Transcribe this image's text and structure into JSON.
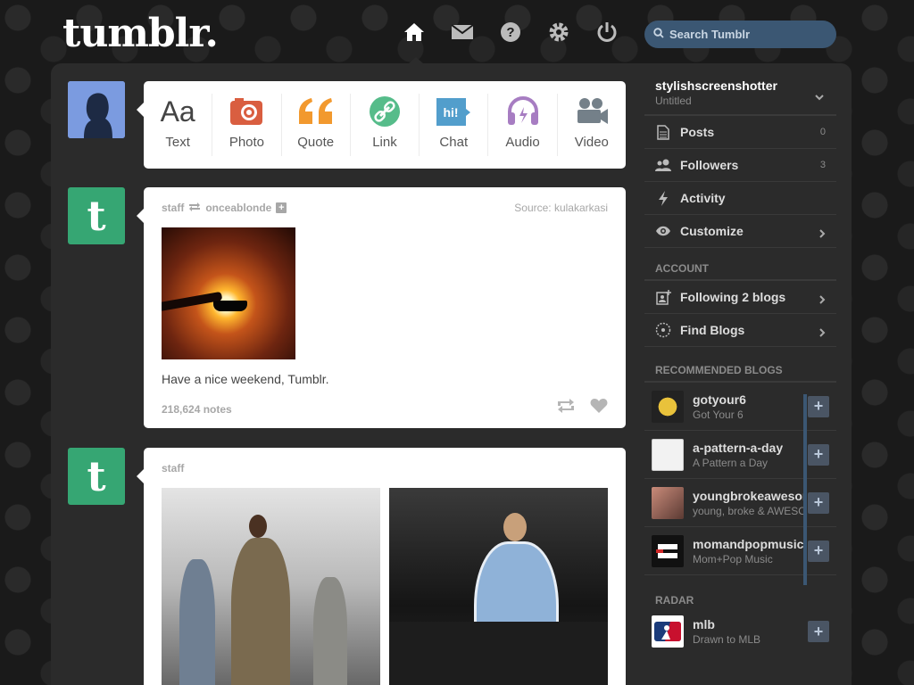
{
  "header": {
    "logo": "tumblr.",
    "nav": [
      {
        "name": "home-icon"
      },
      {
        "name": "mail-icon"
      },
      {
        "name": "help-icon"
      },
      {
        "name": "gear-icon"
      },
      {
        "name": "power-icon"
      }
    ],
    "search_placeholder": "Search Tumblr"
  },
  "post_types": [
    {
      "label": "Text",
      "icon": "text-icon",
      "color": "#444444"
    },
    {
      "label": "Photo",
      "icon": "camera-icon",
      "color": "#d95e40"
    },
    {
      "label": "Quote",
      "icon": "quote-icon",
      "color": "#f2992e"
    },
    {
      "label": "Link",
      "icon": "link-icon",
      "color": "#56bc8a"
    },
    {
      "label": "Chat",
      "icon": "chat-icon",
      "color": "#529ecc"
    },
    {
      "label": "Audio",
      "icon": "headphones-icon",
      "color": "#a77dc2"
    },
    {
      "label": "Video",
      "icon": "video-icon",
      "color": "#748089"
    }
  ],
  "posts": [
    {
      "author": "staff",
      "reblogged_from": "onceablonde",
      "source_label": "Source:",
      "source": "kulakarkasi",
      "caption": "Have a nice weekend, Tumblr.",
      "notes": "218,624 notes"
    },
    {
      "author": "staff"
    }
  ],
  "sidebar": {
    "blog_name": "stylishscreenshotter",
    "blog_subtitle": "Untitled",
    "items": [
      {
        "label": "Posts",
        "count": "0",
        "icon": "posts-icon"
      },
      {
        "label": "Followers",
        "count": "3",
        "icon": "followers-icon"
      },
      {
        "label": "Activity",
        "icon": "lightning-icon"
      },
      {
        "label": "Customize",
        "icon": "eye-icon"
      }
    ],
    "account_heading": "ACCOUNT",
    "account_items": [
      {
        "label": "Following 2 blogs",
        "icon": "following-icon"
      },
      {
        "label": "Find Blogs",
        "icon": "compass-icon"
      }
    ],
    "recommended_heading": "RECOMMENDED BLOGS",
    "recommended": [
      {
        "name": "gotyour6",
        "subtitle": "Got Your 6"
      },
      {
        "name": "a-pattern-a-day",
        "subtitle": "A Pattern a Day"
      },
      {
        "name": "youngbrokeawesome",
        "subtitle": "young, broke & AWESOME"
      },
      {
        "name": "momandpopmusic",
        "subtitle": "Mom+Pop Music"
      }
    ],
    "radar_heading": "RADAR",
    "radar": {
      "name": "mlb",
      "subtitle": "Drawn to MLB"
    }
  },
  "colors": {
    "background": "#1a1a1a",
    "panel": "#2b2b2b",
    "search_bg": "#3b5773",
    "tumblr_green": "#36a673"
  }
}
